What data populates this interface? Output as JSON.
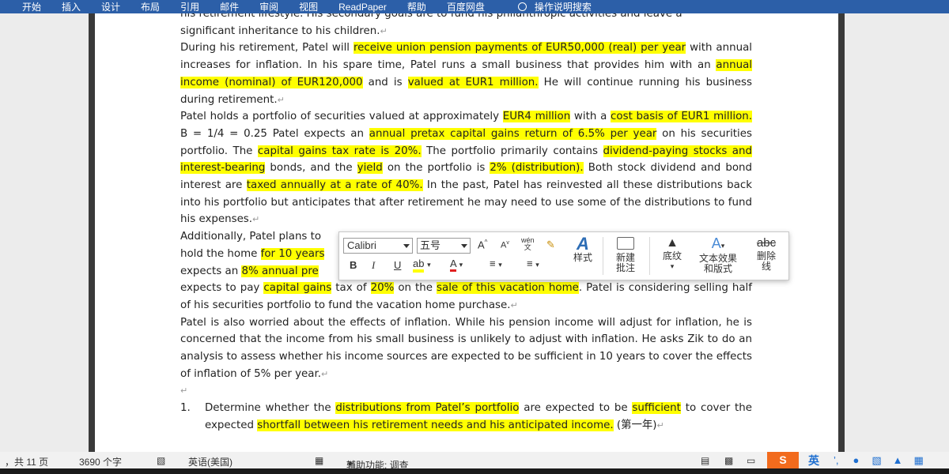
{
  "ribbon": {
    "tabs": [
      "开始",
      "插入",
      "设计",
      "布局",
      "引用",
      "邮件",
      "审阅",
      "视图",
      "ReadPaper",
      "帮助",
      "百度网盘"
    ],
    "search_label": "操作说明搜索"
  },
  "document": {
    "line_top": "his retirement lifestyle. His secondary goals are to fund his philanthropic activities and leave a",
    "p1_end": "significant inheritance to his children.",
    "p2": {
      "a": "During his retirement, Patel will ",
      "h1": "receive union pension payments of EUR50,000 (real) per year",
      "b": " with annual increases for inflation. In his spare time, Patel runs a small business that provides him with an ",
      "h2": "annual income (nominal) of EUR120,000",
      "c": " and is ",
      "h3": "valued at EUR1 million.",
      "d": " He will continue running his business during retirement."
    },
    "p3": {
      "a": "Patel holds a portfolio of securities valued at approximately ",
      "h1": "EUR4 million",
      "b": " with a ",
      "h2": "cost basis of EUR1 million.",
      "c": " B = 1/4 = 0.25 Patel expects an ",
      "h3": "annual pretax capital gains return of 6.5% per year",
      "d": " on his securities portfolio. The ",
      "h4": "capital gains tax rate is 20%.",
      "e": " The portfolio primarily contains ",
      "h5": "dividend-paying stocks and interest-bearing",
      "f": " bonds, and the ",
      "h6": "yield",
      "g": " on the portfolio is ",
      "h7": "2% (distribution).",
      "h": " Both stock dividend and bond interest are ",
      "h8": "taxed annually at a rate of 40%.",
      "i": " In the past, Patel has reinvested all these distributions back into his portfolio but anticipates that after retirement he may need to use some of the distributions to fund his expenses."
    },
    "p4": {
      "l1": "Additionally, Patel plans to",
      "l2a": "hold the home ",
      "l2h": "for 10 years",
      "l3a": "expects an ",
      "l3h": "8% annual pre",
      "l4a": "expects to pay ",
      "l4h1": "capital gains",
      "l4b": " tax of ",
      "l4h2": "20%",
      "l4c": " on the ",
      "l4h3": "sale of this vacation home",
      "l4d": ". Patel is considering selling half of his securities portfolio to fund the vacation home purchase."
    },
    "p5": "Patel is also worried about the effects of inflation. While his pension income will adjust for inflation, he is concerned that the income from his small business is unlikely to adjust with inflation. He asks Zik to do an analysis to assess whether his income sources are expected to be sufficient in 10 years to cover the effects of inflation of 5% per year.",
    "q1": {
      "num": "1.",
      "a": "Determine whether the ",
      "h1": "distributions from Patel’s portfolio",
      "b": " are expected to be ",
      "h2": "sufficient",
      "c": " to cover the expected ",
      "h3": "shortfall between his retirement needs and his anticipated income.",
      "d": " (第一年)"
    },
    "para_mark": "↵"
  },
  "mini_toolbar": {
    "font": "Calibri",
    "size": "五号",
    "grow": "A",
    "shrink": "A",
    "pinyin": "wén",
    "bold": "B",
    "italic": "I",
    "underline": "U",
    "styles_label": "样式",
    "new_comment_l1": "新建",
    "new_comment_l2": "批注",
    "shading_label": "底纹",
    "text_effects_l1": "文本效果",
    "text_effects_l2": "和版式",
    "strike_label_l1": "删除",
    "strike_label_l2": "线",
    "strike_glyph": "abc"
  },
  "status_bar": {
    "pages": "，共 11 页",
    "words": "3690 个字",
    "language": "英语(美国)",
    "accessibility": "辅助功能: 调查",
    "ime_lang": "英"
  },
  "colors": {
    "ribbon": "#2c5fa8",
    "highlight": "#ffff00",
    "font_red": "#e02020",
    "ime_orange": "#f26b1d",
    "tray_blue": "#1f6fd0"
  }
}
